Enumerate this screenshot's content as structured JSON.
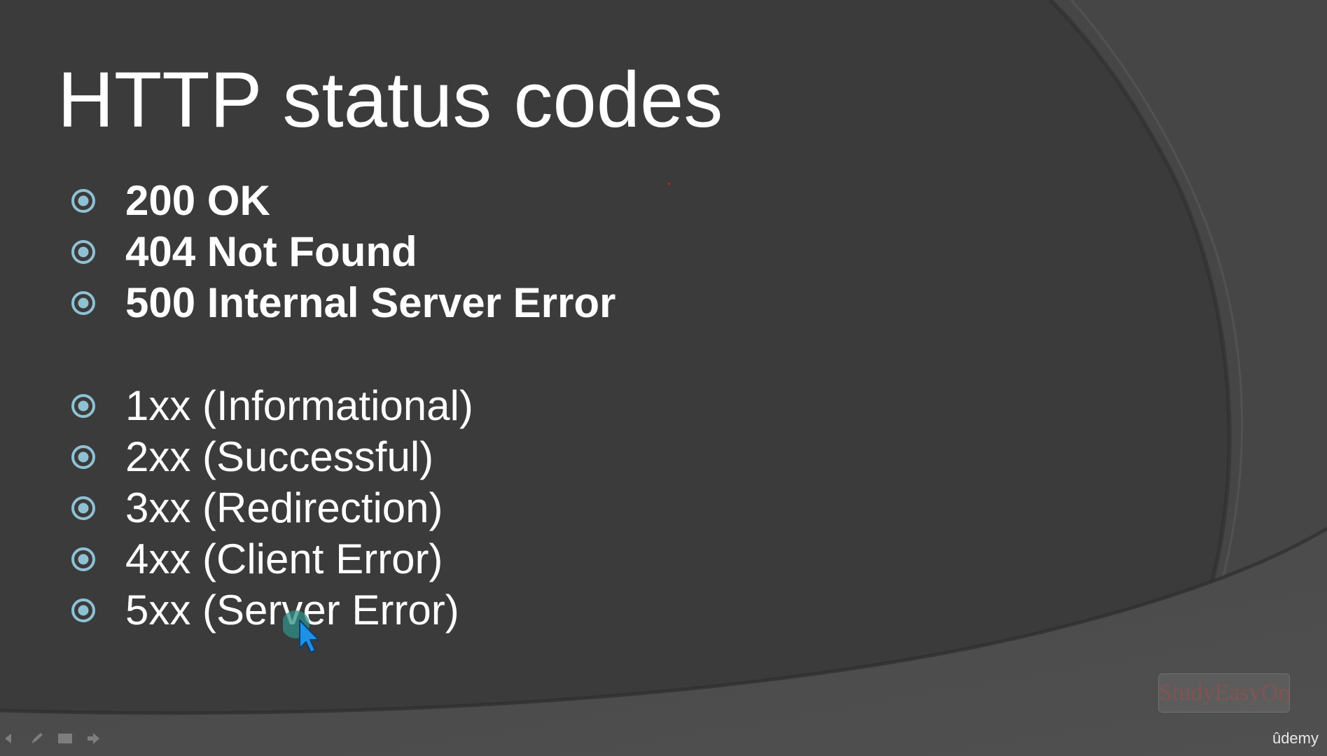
{
  "slide": {
    "title": "HTTP status codes",
    "bullets": [
      {
        "text": "200 OK",
        "bold": true
      },
      {
        "text": "404 Not Found",
        "bold": true
      },
      {
        "text": "500 Internal Server Error",
        "bold": true
      },
      {
        "text": "1xx (Informational)",
        "bold": false
      },
      {
        "text": "2xx (Successful)",
        "bold": false
      },
      {
        "text": "3xx (Redirection)",
        "bold": false
      },
      {
        "text": "4xx (Client Error)",
        "bold": false
      },
      {
        "text": "5xx (Server Error)",
        "bold": false
      }
    ]
  },
  "watermark": {
    "text": "StudyEasyOrg"
  },
  "branding": {
    "text": "ûdemy"
  },
  "colors": {
    "background": "#393939",
    "text": "#ffffff",
    "bullet_accent": "#8fc1d4",
    "cursor": "#1e90e6"
  },
  "icons": {
    "bullet": "target-bullet-icon",
    "cursor": "mouse-pointer-icon",
    "controls": [
      "previous-icon",
      "pen-icon",
      "slides-icon",
      "next-icon"
    ]
  }
}
